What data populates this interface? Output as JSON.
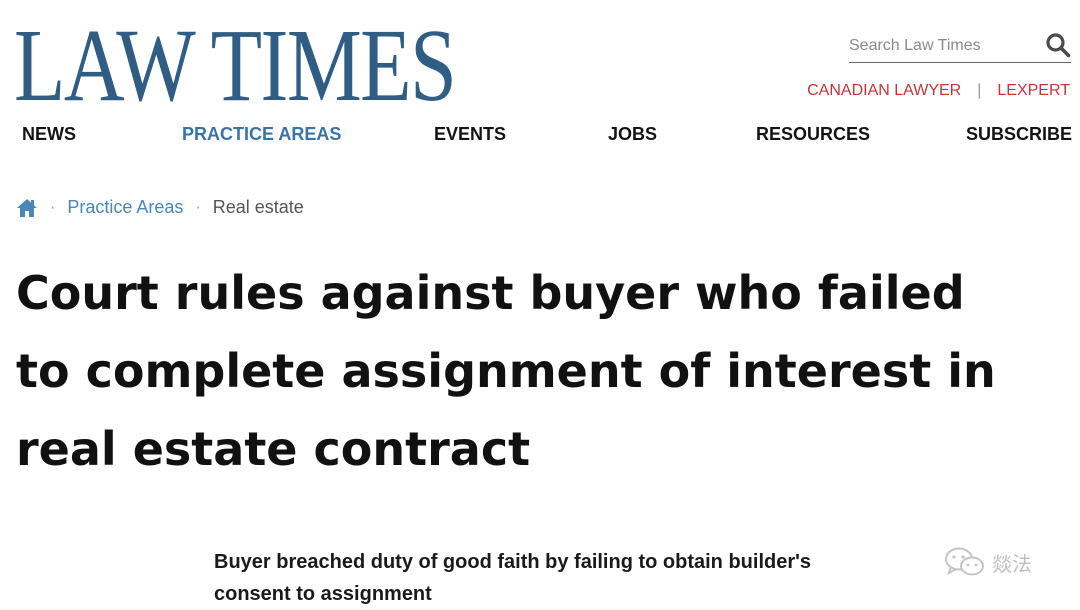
{
  "site": {
    "logo_text": "LAW TIMES"
  },
  "search": {
    "placeholder": "Search Law Times"
  },
  "sister_links": {
    "canadian_lawyer": "CANADIAN LAWYER",
    "separator": "|",
    "lexpert": "LEXPERT"
  },
  "nav": {
    "items": [
      {
        "label": "NEWS"
      },
      {
        "label": "PRACTICE AREAS"
      },
      {
        "label": "EVENTS"
      },
      {
        "label": "JOBS"
      },
      {
        "label": "RESOURCES"
      },
      {
        "label": "SUBSCRIBE"
      }
    ],
    "active": "PRACTICE AREAS"
  },
  "breadcrumb": {
    "separator": "·",
    "items": [
      {
        "label": "Practice Areas"
      },
      {
        "label": "Real estate"
      }
    ]
  },
  "article": {
    "headline": "Court rules against buyer who failed to complete assignment of interest in real estate contract",
    "subheadline": "Buyer breached duty of good faith by failing to obtain builder's consent to assignment"
  },
  "watermark": {
    "text": "燚法"
  },
  "colors": {
    "brand_blue": "#2f5d84",
    "nav_active": "#3a73a6",
    "link_blue": "#4a86b8",
    "sister_red": "#c2363a"
  },
  "icons": {
    "search": "search-icon",
    "home": "home-icon",
    "watermark": "wechat-logo-icon"
  }
}
